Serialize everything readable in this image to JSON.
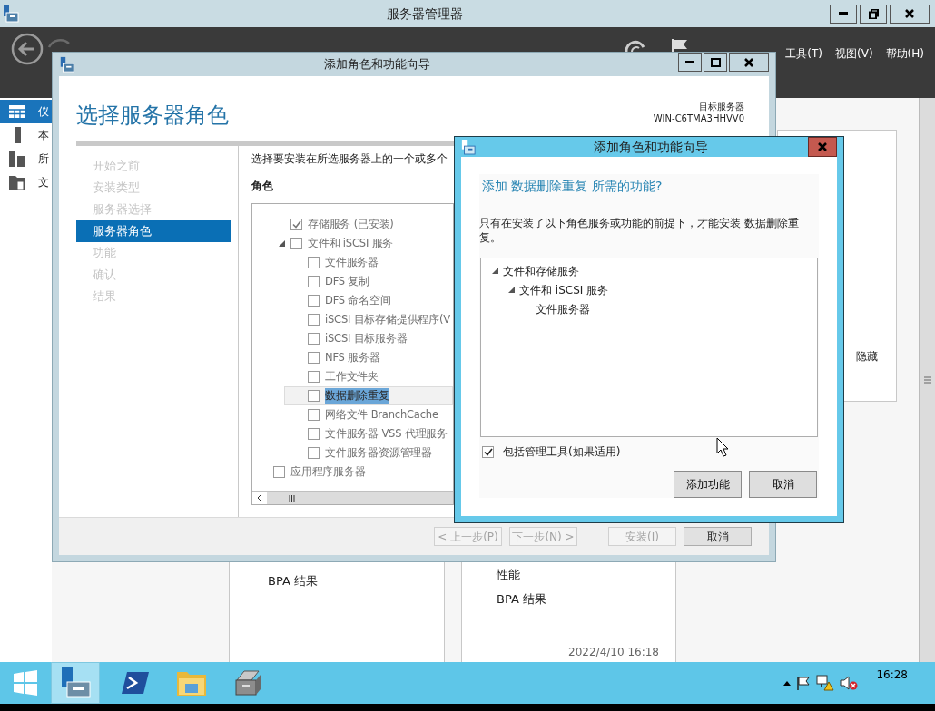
{
  "server_manager": {
    "title": "服务器管理器",
    "menu": [
      "工具(T)",
      "视图(V)",
      "帮助(H)"
    ],
    "sidebar": [
      {
        "label": "仪",
        "selected": true
      },
      {
        "label": "本",
        "selected": false
      },
      {
        "label": "所",
        "selected": false
      },
      {
        "label": "文",
        "selected": false
      }
    ],
    "panels": [
      {
        "items": [
          "BPA 结果"
        ]
      },
      {
        "items": [
          "性能",
          "BPA 结果"
        ],
        "timestamp": "2022/4/10 16:18"
      }
    ],
    "hide_link": "隐藏"
  },
  "wizard": {
    "title": "添加角色和功能向导",
    "heading": "选择服务器角色",
    "target_label": "目标服务器",
    "target_server": "WIN-C6TMA3HHVV0",
    "steps": [
      {
        "label": "开始之前",
        "selected": false
      },
      {
        "label": "安装类型",
        "selected": false
      },
      {
        "label": "服务器选择",
        "selected": false
      },
      {
        "label": "服务器角色",
        "selected": true
      },
      {
        "label": "功能",
        "selected": false
      },
      {
        "label": "确认",
        "selected": false
      },
      {
        "label": "结果",
        "selected": false
      }
    ],
    "description": "选择要安装在所选服务器上的一个或多个",
    "roles_label": "角色",
    "roles": [
      {
        "children": [
          {
            "label": "存储服务 (已安装)",
            "checked": true,
            "selected": false
          },
          {
            "label": "文件和 iSCSI 服务",
            "checked": false,
            "selected": false,
            "expanded": true,
            "children": [
              {
                "label": "文件服务器",
                "checked": false,
                "selected": false
              },
              {
                "label": "DFS 复制",
                "checked": false,
                "selected": false
              },
              {
                "label": "DFS 命名空间",
                "checked": false,
                "selected": false
              },
              {
                "label": "iSCSI 目标存储提供程序(V",
                "checked": false,
                "selected": false
              },
              {
                "label": "iSCSI 目标服务器",
                "checked": false,
                "selected": false
              },
              {
                "label": "NFS 服务器",
                "checked": false,
                "selected": false
              },
              {
                "label": "工作文件夹",
                "checked": false,
                "selected": false
              },
              {
                "label": "数据删除重复",
                "checked": false,
                "selected": true
              },
              {
                "label": "网络文件 BranchCache",
                "checked": false,
                "selected": false
              },
              {
                "label": "文件服务器 VSS 代理服务",
                "checked": false,
                "selected": false
              },
              {
                "label": "文件服务器资源管理器",
                "checked": false,
                "selected": false
              }
            ]
          }
        ]
      },
      {
        "label": "应用程序服务器",
        "checked": false,
        "selected": false
      }
    ],
    "buttons": [
      {
        "label": "< 上一步(P)",
        "disabled": true
      },
      {
        "label": "下一步(N) >",
        "disabled": true
      },
      {
        "label": "安装(I)",
        "disabled": true
      },
      {
        "label": "取消",
        "disabled": false
      }
    ]
  },
  "dialog": {
    "title": "添加角色和功能向导",
    "heading": "添加 数据删除重复 所需的功能?",
    "message": "只有在安装了以下角色服务或功能的前提下，才能安装 数据删除重复。",
    "features": [
      {
        "label": "文件和存储服务",
        "expanded": true,
        "children": [
          {
            "label": "文件和 iSCSI 服务",
            "expanded": true,
            "children": [
              {
                "label": "文件服务器"
              }
            ]
          }
        ]
      }
    ],
    "include_tools": {
      "label": "包括管理工具(如果适用)",
      "checked": true
    },
    "buttons": [
      "添加功能",
      "取消"
    ]
  },
  "taskbar": {
    "apps": [
      {
        "kind": "server-manager",
        "selected": true
      },
      {
        "kind": "powershell",
        "selected": false
      },
      {
        "kind": "explorer",
        "selected": false
      },
      {
        "kind": "toolbox",
        "selected": false
      }
    ],
    "clock": "16:28"
  }
}
